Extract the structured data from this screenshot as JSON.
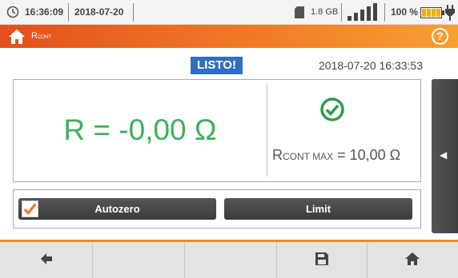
{
  "status": {
    "time": "16:36:09",
    "date": "2018-07-20",
    "memory": "1.8 GB",
    "battery": "100 %"
  },
  "titlebar": {
    "title_main": "R",
    "title_sub": "CONT",
    "help": "?"
  },
  "header": {
    "status_badge": "LISTO!",
    "datetime": "2018-07-20 16:33:53"
  },
  "result": {
    "value": "R = -0,00 Ω",
    "limit_symbol": "R",
    "limit_sub": "CONT MAX",
    "limit_value": " = 10,00 Ω"
  },
  "controls": {
    "autozero_label": "Autozero",
    "autozero_checked": true,
    "limit_label": "Limit"
  },
  "side_tab": {
    "arrow": "◀"
  },
  "colors": {
    "accent": "#f07a28",
    "result_green": "#3db05a",
    "badge_blue": "#2f6fc0"
  },
  "icons": [
    "clock-icon",
    "sd-card-icon",
    "signal-icon",
    "battery-icon",
    "plug-icon",
    "home-icon",
    "help-icon",
    "check-circle-icon",
    "back-arrow-icon",
    "save-icon"
  ]
}
